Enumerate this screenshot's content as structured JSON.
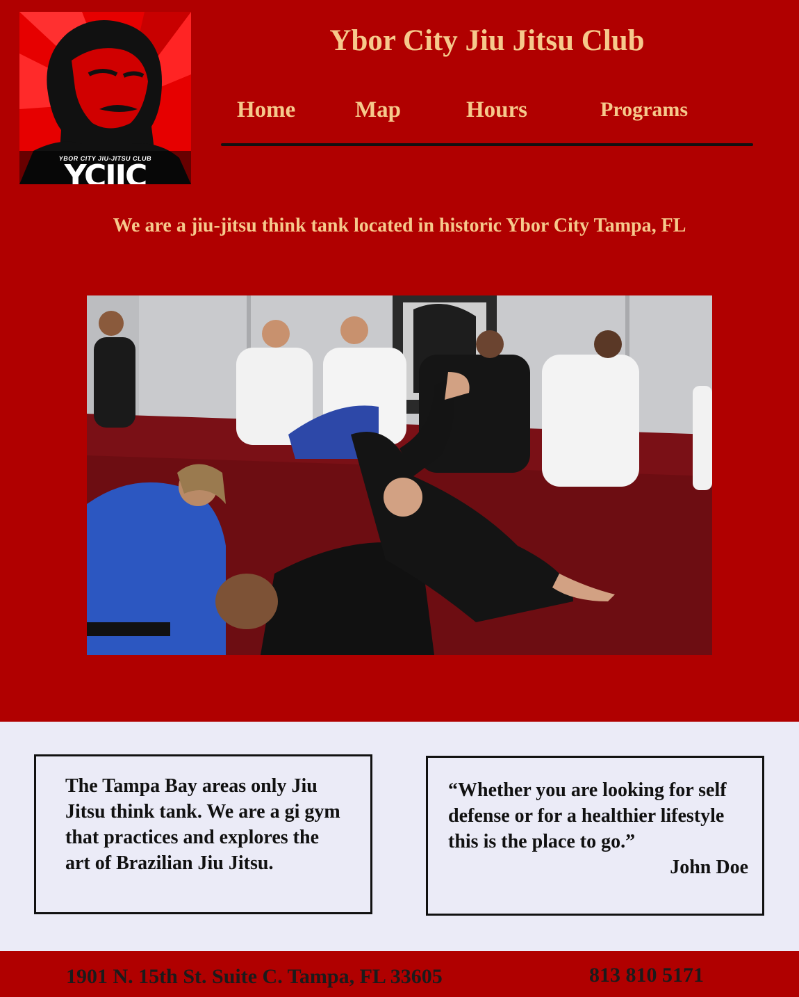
{
  "site": {
    "title": "Ybor City Jiu Jitsu Club",
    "tagline": "We are a jiu-jitsu think tank located in historic Ybor City Tampa, FL"
  },
  "logo": {
    "small_text": "YBOR CITY JIU-JITSU CLUB",
    "big_text": "YCJJC"
  },
  "nav": {
    "items": [
      {
        "label": "Home"
      },
      {
        "label": "Map"
      },
      {
        "label": "Hours"
      },
      {
        "label": "Programs"
      }
    ]
  },
  "about": {
    "text": "The Tampa Bay areas only Jiu Jitsu think tank. We are a gi gym that practices and explores the art of Brazilian Jiu Jitsu."
  },
  "testimonial": {
    "quote": "“Whether you are looking for self defense or for a healthier lifestyle this is the place to go.”",
    "author": "John Doe"
  },
  "footer": {
    "address": "1901 N. 15th St. Suite C. Tampa, FL 33605",
    "phone": "813 810 5171"
  },
  "colors": {
    "primary_red": "#b00000",
    "accent_gold": "#f6c98c",
    "light_bg": "#ebebf7",
    "text_dark": "#111111"
  }
}
